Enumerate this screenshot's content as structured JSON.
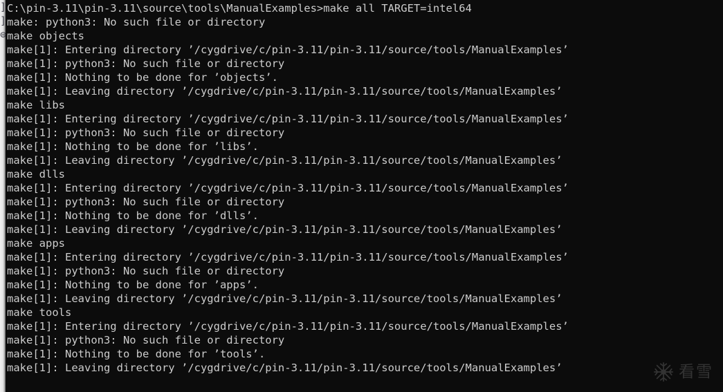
{
  "window": {
    "type": "windows-command-prompt",
    "background_color": "#0c0c0c",
    "text_color": "#cccccc",
    "left_edge_artifact": "]\n]\n⊜"
  },
  "terminal": {
    "prompt_path": "C:\\pin-3.11\\pin-3.11\\source\\tools\\ManualExamples",
    "command": "make all TARGET=intel64",
    "build_directory": "/cygdrive/c/pin-3.11/pin-3.11/source/tools/ManualExamples",
    "targets": [
      "objects",
      "libs",
      "dlls",
      "apps",
      "tools"
    ],
    "lines": [
      "C:\\pin-3.11\\pin-3.11\\source\\tools\\ManualExamples>make all TARGET=intel64",
      "make: python3: No such file or directory",
      "make objects",
      "make[1]: Entering directory '/cygdrive/c/pin-3.11/pin-3.11/source/tools/ManualExamples'",
      "make[1]: python3: No such file or directory",
      "make[1]: Nothing to be done for 'objects'.",
      "make[1]: Leaving directory '/cygdrive/c/pin-3.11/pin-3.11/source/tools/ManualExamples'",
      "make libs",
      "make[1]: Entering directory '/cygdrive/c/pin-3.11/pin-3.11/source/tools/ManualExamples'",
      "make[1]: python3: No such file or directory",
      "make[1]: Nothing to be done for 'libs'.",
      "make[1]: Leaving directory '/cygdrive/c/pin-3.11/pin-3.11/source/tools/ManualExamples'",
      "make dlls",
      "make[1]: Entering directory '/cygdrive/c/pin-3.11/pin-3.11/source/tools/ManualExamples'",
      "make[1]: python3: No such file or directory",
      "make[1]: Nothing to be done for 'dlls'.",
      "make[1]: Leaving directory '/cygdrive/c/pin-3.11/pin-3.11/source/tools/ManualExamples'",
      "make apps",
      "make[1]: Entering directory '/cygdrive/c/pin-3.11/pin-3.11/source/tools/ManualExamples'",
      "make[1]: python3: No such file or directory",
      "make[1]: Nothing to be done for 'apps'.",
      "make[1]: Leaving directory '/cygdrive/c/pin-3.11/pin-3.11/source/tools/ManualExamples'",
      "make tools",
      "make[1]: Entering directory '/cygdrive/c/pin-3.11/pin-3.11/source/tools/ManualExamples'",
      "make[1]: python3: No such file or directory",
      "make[1]: Nothing to be done for 'tools'.",
      "make[1]: Leaving directory '/cygdrive/c/pin-3.11/pin-3.11/source/tools/ManualExamples'"
    ]
  },
  "watermark": {
    "text": "看雪",
    "icon": "snowflake-icon",
    "color": "#8d8d8d"
  }
}
